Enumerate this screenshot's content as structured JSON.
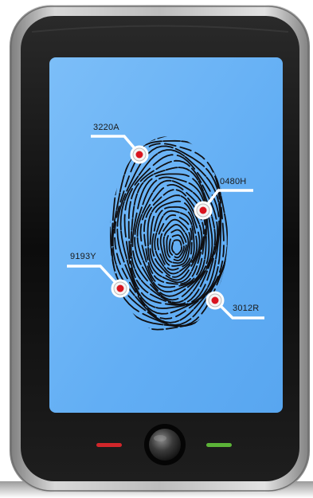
{
  "colors": {
    "screen": "#62aef4",
    "screen_highlight": "#8cc8fb",
    "phone_body": "#111111",
    "phone_frame": "#a9a9a9",
    "marker_dot": "#d9141f",
    "marker_ring": "#ffffff",
    "call_button": "#d1262a",
    "end_button": "#5cb338",
    "fingerprint": "#0f0f12"
  },
  "icons": {
    "fingerprint": "fingerprint-icon",
    "marker": "target-marker-icon",
    "call_button": "red-call-button-icon",
    "end_button": "green-end-button-icon",
    "home_button": "home-button-icon"
  },
  "callouts": [
    {
      "label": "3220A"
    },
    {
      "label": "0480H"
    },
    {
      "label": "9193Y"
    },
    {
      "label": "3012R"
    }
  ]
}
